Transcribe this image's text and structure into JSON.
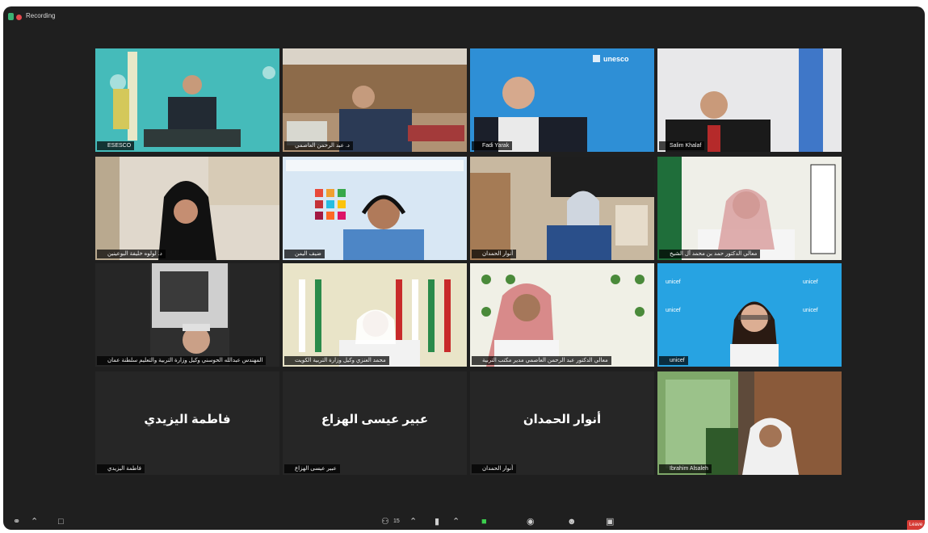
{
  "recording": {
    "label": "Recording"
  },
  "tiles": [
    {
      "name": "ESESCO",
      "type": "video"
    },
    {
      "name": "د. عبد الرحمن العاصمي",
      "type": "video"
    },
    {
      "name": "Fadi Yarak",
      "type": "video"
    },
    {
      "name": "Salim Khalaf",
      "type": "video"
    },
    {
      "name": "د. لولوه خليفة البوعينين",
      "type": "video"
    },
    {
      "name": "ضيف اليمن",
      "type": "video"
    },
    {
      "name": "أنوار الحمدان",
      "type": "video"
    },
    {
      "name": "معالي الدكتور حمد بن محمد آل الشيخ",
      "type": "video"
    },
    {
      "name": "المهندس عبدالله الحوسني وكيل وزارة التربية والتعليم سلطنة عمان",
      "type": "video"
    },
    {
      "name": "محمد العنزي وكيل وزارة التربية الكويت",
      "type": "video"
    },
    {
      "name": "معالي الدكتور عبد الرحمن العاصمي مدير مكتب التربية",
      "type": "video"
    },
    {
      "name": "unicef",
      "type": "video"
    },
    {
      "name": "فاطمة اليزيدي",
      "type": "name"
    },
    {
      "name": "عبير عيسى الهزاع",
      "type": "name"
    },
    {
      "name": "أنوار الحمدان",
      "type": "name"
    },
    {
      "name": "Ibrahim Alsaleh",
      "type": "video"
    }
  ],
  "toolbar": {
    "participants_count": "15",
    "leave_label": "Leave"
  },
  "colors": {
    "active_border": "#3ccf4e",
    "leave": "#d63b35",
    "unesco_blue": "#2e8fd6",
    "unicef_blue": "#27a3e2"
  }
}
